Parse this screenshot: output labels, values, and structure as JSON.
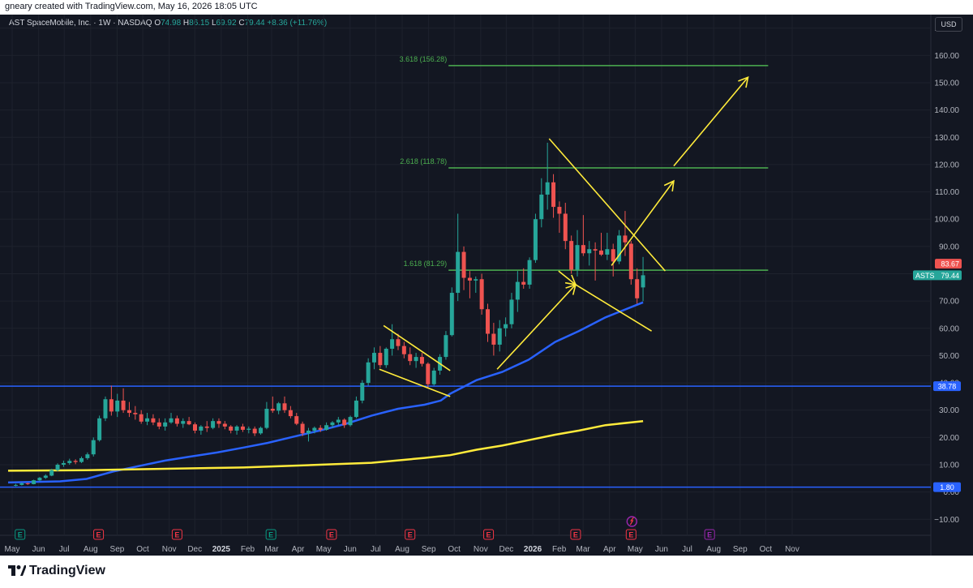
{
  "header": {
    "credit": "gneary created with TradingView.com, May 16, 2026 18:05 UTC"
  },
  "symbol": {
    "name": "AST SpaceMobile, Inc. · 1W · NASDAQ",
    "open_label": "O",
    "open": "74.98",
    "high_label": "H",
    "high": "86.15",
    "low_label": "L",
    "low": "69.92",
    "close_label": "C",
    "close": "79.44",
    "change": "+8.36 (+11.76%)"
  },
  "currency": "USD",
  "footer": {
    "brand": "TradingView"
  },
  "colors": {
    "background": "#131722",
    "grid": "#1e222d",
    "up": "#26a69a",
    "down": "#ef5350",
    "ma_fast": "#2962ff",
    "ma_slow": "#ffeb3b",
    "horizontal_level": "#2962ff",
    "fib_level": "#4caf50",
    "annotation": "#ffeb3b",
    "earnings_past": "#f23645",
    "earnings_first": "#089981",
    "earnings_future": "#9c27b0"
  },
  "chart_data": {
    "type": "candlestick",
    "symbol": "ASTS",
    "interval": "1W",
    "ylim": [
      -12,
      172
    ],
    "y_ticks": [
      "170.00",
      "160.00",
      "150.00",
      "140.00",
      "130.00",
      "120.00",
      "110.00",
      "100.00",
      "90.00",
      "80.00",
      "70.00",
      "60.00",
      "50.00",
      "40.00",
      "30.00",
      "20.00",
      "10.00",
      "0.00",
      "−10.00"
    ],
    "x_ticks": [
      "May",
      "Jun",
      "Jul",
      "Aug",
      "Sep",
      "Oct",
      "Nov",
      "Dec",
      "2025",
      "Feb",
      "Mar",
      "Apr",
      "May",
      "Jun",
      "Jul",
      "Aug",
      "Sep",
      "Oct",
      "Nov",
      "Dec",
      "2026",
      "Feb",
      "Mar",
      "Apr",
      "May",
      "Jun",
      "Jul",
      "Aug",
      "Sep",
      "Oct",
      "Nov"
    ],
    "x_start": "2024-05-01",
    "candles": [
      [
        "2024-05-10",
        2.4,
        3.0,
        2.1,
        2.6
      ],
      [
        "2024-05-17",
        2.6,
        3.5,
        2.4,
        3.2
      ],
      [
        "2024-05-24",
        3.2,
        3.4,
        2.6,
        2.9
      ],
      [
        "2024-05-31",
        2.9,
        4.5,
        2.8,
        4.3
      ],
      [
        "2024-06-07",
        4.3,
        5.5,
        4.0,
        5.2
      ],
      [
        "2024-06-14",
        5.2,
        6.5,
        4.8,
        6.0
      ],
      [
        "2024-06-21",
        6.0,
        8.5,
        5.8,
        8.0
      ],
      [
        "2024-06-28",
        8.0,
        10.5,
        7.6,
        10.0
      ],
      [
        "2024-07-05",
        10.0,
        11.5,
        9.2,
        10.6
      ],
      [
        "2024-07-12",
        10.6,
        12.2,
        10.0,
        11.4
      ],
      [
        "2024-07-19",
        11.4,
        12.0,
        10.2,
        11.0
      ],
      [
        "2024-07-26",
        11.0,
        13.0,
        10.6,
        12.4
      ],
      [
        "2024-08-02",
        12.4,
        14.5,
        11.8,
        13.8
      ],
      [
        "2024-08-09",
        13.8,
        20.0,
        13.0,
        19.0
      ],
      [
        "2024-08-16",
        19.0,
        28.0,
        18.5,
        27.0
      ],
      [
        "2024-08-23",
        27.0,
        35.0,
        26.0,
        34.0
      ],
      [
        "2024-08-30",
        34.0,
        39.0,
        28.0,
        29.5
      ],
      [
        "2024-09-06",
        29.5,
        36.0,
        27.5,
        33.5
      ],
      [
        "2024-09-13",
        33.5,
        38.0,
        29.0,
        30.0
      ],
      [
        "2024-09-20",
        30.0,
        33.0,
        27.5,
        29.0
      ],
      [
        "2024-09-27",
        29.0,
        31.5,
        26.5,
        28.5
      ],
      [
        "2024-10-04",
        28.5,
        30.0,
        25.0,
        25.8
      ],
      [
        "2024-10-11",
        25.8,
        29.0,
        24.5,
        27.0
      ],
      [
        "2024-10-18",
        27.0,
        28.5,
        24.5,
        25.5
      ],
      [
        "2024-10-25",
        25.5,
        27.0,
        23.0,
        24.0
      ],
      [
        "2024-11-01",
        24.0,
        27.0,
        22.5,
        25.5
      ],
      [
        "2024-11-08",
        25.5,
        29.0,
        25.0,
        27.0
      ],
      [
        "2024-11-15",
        27.0,
        28.0,
        24.0,
        25.0
      ],
      [
        "2024-11-22",
        25.0,
        27.0,
        23.5,
        26.0
      ],
      [
        "2024-11-29",
        26.0,
        27.5,
        24.5,
        24.8
      ],
      [
        "2024-12-06",
        24.8,
        25.5,
        21.5,
        22.5
      ],
      [
        "2024-12-13",
        22.5,
        24.5,
        21.0,
        24.0
      ],
      [
        "2024-12-20",
        24.0,
        26.0,
        22.0,
        23.5
      ],
      [
        "2024-12-27",
        23.5,
        27.0,
        23.0,
        26.0
      ],
      [
        "2025-01-03",
        26.0,
        27.0,
        23.5,
        25.0
      ],
      [
        "2025-01-10",
        25.0,
        26.0,
        23.0,
        24.0
      ],
      [
        "2025-01-17",
        24.0,
        24.5,
        21.5,
        22.5
      ],
      [
        "2025-01-24",
        22.5,
        24.5,
        21.0,
        24.0
      ],
      [
        "2025-01-31",
        24.0,
        25.0,
        22.0,
        22.8
      ],
      [
        "2025-02-07",
        22.8,
        24.0,
        21.5,
        23.2
      ],
      [
        "2025-02-14",
        23.2,
        24.0,
        20.5,
        21.5
      ],
      [
        "2025-02-21",
        21.5,
        24.0,
        21.0,
        23.5
      ],
      [
        "2025-02-28",
        23.5,
        33.0,
        23.0,
        30.5
      ],
      [
        "2025-03-07",
        30.5,
        35.0,
        29.0,
        29.8
      ],
      [
        "2025-03-14",
        29.8,
        33.0,
        28.5,
        32.5
      ],
      [
        "2025-03-21",
        32.5,
        35.0,
        29.0,
        30.0
      ],
      [
        "2025-03-28",
        30.0,
        31.5,
        27.0,
        27.8
      ],
      [
        "2025-04-04",
        27.8,
        29.0,
        24.5,
        25.0
      ],
      [
        "2025-04-11",
        25.0,
        25.8,
        20.5,
        21.5
      ],
      [
        "2025-04-18",
        21.5,
        23.5,
        18.5,
        22.5
      ],
      [
        "2025-04-25",
        22.5,
        24.0,
        21.5,
        23.5
      ],
      [
        "2025-05-02",
        23.5,
        24.5,
        22.0,
        22.8
      ],
      [
        "2025-05-09",
        22.8,
        25.5,
        22.5,
        24.5
      ],
      [
        "2025-05-16",
        24.5,
        26.0,
        23.5,
        25.5
      ],
      [
        "2025-05-23",
        25.5,
        27.5,
        24.5,
        26.5
      ],
      [
        "2025-05-30",
        26.5,
        27.0,
        23.5,
        24.5
      ],
      [
        "2025-06-06",
        24.5,
        28.0,
        24.0,
        27.5
      ],
      [
        "2025-06-13",
        27.5,
        35.0,
        27.0,
        33.5
      ],
      [
        "2025-06-20",
        33.5,
        41.0,
        32.5,
        40.0
      ],
      [
        "2025-06-27",
        40.0,
        49.0,
        39.0,
        47.5
      ],
      [
        "2025-07-04",
        47.5,
        53.0,
        45.0,
        51.0
      ],
      [
        "2025-07-11",
        51.0,
        53.5,
        45.5,
        46.5
      ],
      [
        "2025-07-18",
        46.5,
        53.0,
        45.5,
        52.5
      ],
      [
        "2025-07-25",
        52.5,
        61.5,
        50.0,
        56.0
      ],
      [
        "2025-08-01",
        56.0,
        58.0,
        52.0,
        53.5
      ],
      [
        "2025-08-08",
        53.5,
        55.0,
        49.0,
        50.5
      ],
      [
        "2025-08-15",
        50.5,
        53.0,
        46.5,
        48.0
      ],
      [
        "2025-08-22",
        48.0,
        51.0,
        45.5,
        49.5
      ],
      [
        "2025-08-29",
        49.5,
        51.0,
        46.0,
        47.0
      ],
      [
        "2025-09-05",
        47.0,
        47.5,
        38.0,
        39.5
      ],
      [
        "2025-09-12",
        39.5,
        45.5,
        39.0,
        44.5
      ],
      [
        "2025-09-19",
        44.5,
        50.5,
        43.0,
        49.5
      ],
      [
        "2025-09-26",
        49.5,
        59.0,
        48.5,
        57.5
      ],
      [
        "2025-10-03",
        57.5,
        75.0,
        57.0,
        73.0
      ],
      [
        "2025-10-10",
        73.0,
        102.0,
        70.0,
        88.0
      ],
      [
        "2025-10-17",
        88.0,
        90.0,
        74.0,
        78.5
      ],
      [
        "2025-10-24",
        78.5,
        81.0,
        71.0,
        77.5
      ],
      [
        "2025-10-31",
        77.5,
        79.0,
        73.0,
        78.0
      ],
      [
        "2025-11-07",
        78.0,
        80.0,
        65.0,
        67.0
      ],
      [
        "2025-11-14",
        67.0,
        69.0,
        55.0,
        58.0
      ],
      [
        "2025-11-21",
        58.0,
        62.0,
        50.0,
        54.0
      ],
      [
        "2025-11-28",
        54.0,
        63.0,
        51.5,
        60.0
      ],
      [
        "2025-12-05",
        60.0,
        64.0,
        57.0,
        61.5
      ],
      [
        "2025-12-12",
        61.5,
        73.0,
        60.0,
        70.5
      ],
      [
        "2025-12-19",
        70.5,
        81.0,
        66.0,
        77.0
      ],
      [
        "2025-12-26",
        77.0,
        82.0,
        74.5,
        76.0
      ],
      [
        "2026-01-02",
        76.0,
        86.0,
        74.5,
        85.0
      ],
      [
        "2026-01-09",
        85.0,
        102.0,
        84.0,
        100.0
      ],
      [
        "2026-01-16",
        100.0,
        115.0,
        97.0,
        109.0
      ],
      [
        "2026-01-23",
        109.0,
        128.0,
        103.5,
        113.5
      ],
      [
        "2026-01-30",
        113.5,
        116.5,
        100.5,
        104.5
      ],
      [
        "2026-02-06",
        104.5,
        106.5,
        95.0,
        102.0
      ],
      [
        "2026-02-13",
        102.0,
        106.0,
        89.0,
        92.0
      ],
      [
        "2026-02-20",
        92.0,
        94.0,
        80.0,
        81.5
      ],
      [
        "2026-02-27",
        81.5,
        96.0,
        79.0,
        90.5
      ],
      [
        "2026-03-06",
        90.5,
        101.5,
        86.5,
        87.5
      ],
      [
        "2026-03-13",
        87.5,
        92.0,
        83.0,
        89.0
      ],
      [
        "2026-03-20",
        89.0,
        91.5,
        77.5,
        88.5
      ],
      [
        "2026-03-27",
        88.5,
        95.0,
        86.5,
        87.0
      ],
      [
        "2026-04-03",
        87.0,
        95.0,
        85.0,
        89.0
      ],
      [
        "2026-04-10",
        89.0,
        91.0,
        79.0,
        84.5
      ],
      [
        "2026-04-17",
        84.5,
        96.0,
        83.5,
        94.0
      ],
      [
        "2026-04-24",
        94.0,
        103.0,
        86.5,
        91.5
      ],
      [
        "2026-05-01",
        91.0,
        92.0,
        76.0,
        78.0
      ],
      [
        "2026-05-08",
        78.0,
        82.0,
        69.0,
        71.0
      ],
      [
        "2026-05-15",
        74.98,
        86.15,
        69.92,
        79.44
      ]
    ],
    "moving_averages": [
      {
        "color": "#2962ff",
        "points": [
          [
            "2024-05-01",
            3.5
          ],
          [
            "2024-07-01",
            3.9
          ],
          [
            "2024-08-01",
            4.8
          ],
          [
            "2024-09-01",
            7.5
          ],
          [
            "2024-10-01",
            9.5
          ],
          [
            "2024-11-01",
            11.5
          ],
          [
            "2024-12-01",
            13.0
          ],
          [
            "2025-01-01",
            14.5
          ],
          [
            "2025-02-01",
            16.3
          ],
          [
            "2025-03-01",
            18.0
          ],
          [
            "2025-04-01",
            20.3
          ],
          [
            "2025-05-01",
            22.5
          ],
          [
            "2025-06-01",
            25.0
          ],
          [
            "2025-07-01",
            28.0
          ],
          [
            "2025-08-01",
            30.5
          ],
          [
            "2025-09-01",
            32.0
          ],
          [
            "2025-09-20",
            33.5
          ],
          [
            "2025-10-01",
            36.0
          ],
          [
            "2025-11-01",
            41.0
          ],
          [
            "2025-12-01",
            44.0
          ],
          [
            "2026-01-01",
            48.5
          ],
          [
            "2026-02-01",
            55.0
          ],
          [
            "2026-03-01",
            59.0
          ],
          [
            "2026-04-01",
            64.0
          ],
          [
            "2026-05-15",
            69.5
          ]
        ]
      },
      {
        "color": "#ffeb3b",
        "points": [
          [
            "2024-05-01",
            7.8
          ],
          [
            "2024-08-01",
            8.0
          ],
          [
            "2024-11-01",
            8.5
          ],
          [
            "2025-02-01",
            9.0
          ],
          [
            "2025-05-01",
            10.0
          ],
          [
            "2025-07-01",
            10.7
          ],
          [
            "2025-09-01",
            12.5
          ],
          [
            "2025-10-01",
            13.5
          ],
          [
            "2025-11-01",
            15.5
          ],
          [
            "2025-12-01",
            17.0
          ],
          [
            "2026-01-01",
            19.0
          ],
          [
            "2026-02-01",
            21.0
          ],
          [
            "2026-03-01",
            22.5
          ],
          [
            "2026-04-01",
            24.5
          ],
          [
            "2026-05-15",
            26.0
          ]
        ]
      }
    ],
    "horizontal_levels": [
      {
        "value": 38.78,
        "label": "38.78"
      },
      {
        "value": 1.8,
        "label": "1.80"
      }
    ],
    "fib_levels": [
      {
        "ratio": "3.618",
        "value": 156.28,
        "label": "3.618 (156.28)",
        "x_from": "2025-10-01",
        "x_to": "2026-10-01"
      },
      {
        "ratio": "2.618",
        "value": 118.78,
        "label": "2.618 (118.78)",
        "x_from": "2025-10-01",
        "x_to": "2026-10-01"
      },
      {
        "ratio": "1.618",
        "value": 81.29,
        "label": "1.618 (81.29)",
        "x_from": "2025-10-01",
        "x_to": "2026-10-01"
      }
    ],
    "annotations": [
      {
        "type": "line",
        "from": [
          "2025-07-15",
          61.0
        ],
        "to": [
          "2025-10-01",
          44.5
        ]
      },
      {
        "type": "line",
        "from": [
          "2025-07-10",
          45.0
        ],
        "to": [
          "2025-10-01",
          35.0
        ]
      },
      {
        "type": "arrow",
        "from": [
          "2025-11-25",
          45.0
        ],
        "to": [
          "2026-02-25",
          76.0
        ]
      },
      {
        "type": "line",
        "from": [
          "2026-01-25",
          129.5
        ],
        "to": [
          "2026-06-10",
          81.0
        ]
      },
      {
        "type": "arrow",
        "from": [
          "2026-02-05",
          81.0
        ],
        "to": [
          "2026-02-25",
          76.0
        ]
      },
      {
        "type": "line",
        "from": [
          "2026-02-25",
          76.0
        ],
        "to": [
          "2026-05-25",
          59.0
        ]
      },
      {
        "type": "arrow",
        "from": [
          "2026-04-08",
          83.0
        ],
        "to": [
          "2026-06-20",
          114.0
        ]
      },
      {
        "type": "arrow",
        "from": [
          "2026-06-20",
          119.5
        ],
        "to": [
          "2026-09-15",
          152.0
        ]
      }
    ],
    "earnings_markers": [
      {
        "date": "2024-05-15",
        "label": "E",
        "kind": "first"
      },
      {
        "date": "2024-08-15",
        "label": "E",
        "kind": "past"
      },
      {
        "date": "2024-11-15",
        "label": "E",
        "kind": "past"
      },
      {
        "date": "2025-03-05",
        "label": "E",
        "kind": "first"
      },
      {
        "date": "2025-05-15",
        "label": "E",
        "kind": "past"
      },
      {
        "date": "2025-08-15",
        "label": "E",
        "kind": "past"
      },
      {
        "date": "2025-11-15",
        "label": "E",
        "kind": "past"
      },
      {
        "date": "2026-02-25",
        "label": "E",
        "kind": "past"
      },
      {
        "date": "2026-05-01",
        "label": "E",
        "kind": "past"
      },
      {
        "date": "2026-08-01",
        "label": "E",
        "kind": "future"
      }
    ],
    "price_labels": [
      {
        "value": 83.67,
        "label": "83.67",
        "kind": "prev"
      },
      {
        "value": 79.44,
        "label": "79.44",
        "symbol": "ASTS",
        "kind": "last"
      }
    ]
  }
}
